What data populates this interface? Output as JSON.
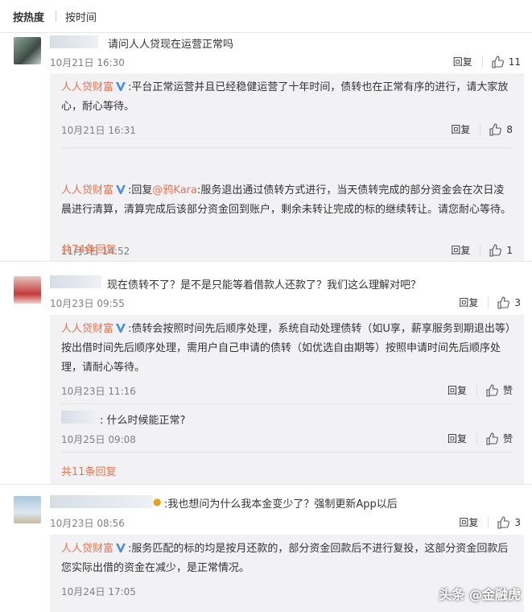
{
  "sort": {
    "hot_label": "按热度",
    "time_label": "按时间"
  },
  "threads": [
    {
      "text": "请问人人贷现在运营正常吗",
      "time": "10月21日 16:30",
      "reply_label": "回复",
      "likes": "11",
      "replies": [
        {
          "name": "人人贷财富",
          "prefix": ":",
          "text": "平台正常运营并且已经稳健运营了十年时间，债转也在正常有序的进行，请大家放心，耐心等待。",
          "time": "10月21日 16:31",
          "reply_label": "回复",
          "likes": "8"
        },
        {
          "name": "人人贷财富",
          "prefix": ":",
          "reply_word": "回复",
          "mention": "@鸦Kara",
          "text": ":服务退出通过债转方式进行，当天债转完成的部分资金会在次日凌晨进行清算，清算完成后该部分资金回到账户，剩余未转让完成的标的继续转让。请您耐心等待。",
          "time": "11月3日 14:52",
          "reply_label": "回复",
          "likes": "1"
        }
      ],
      "more": "共74条回复"
    },
    {
      "text": "现在债转不了？是不是只能等着借款人还款了？我们这么理解对吧？",
      "time": "10月23日 09:55",
      "reply_label": "回复",
      "likes": "3",
      "replies": [
        {
          "name": "人人贷财富",
          "prefix": ":",
          "text": "债转会按照时间先后顺序处理，系统自动处理债转（如U享，薪享服务到期退出等）按出借时间先后顺序处理，需用户自己申请的债转（如优选自由期等）按照申请时间先后顺序处理，请耐心等待。",
          "time": "10月23日 11:16",
          "reply_label": "回复",
          "likes": "赞"
        },
        {
          "name": "",
          "prefix": ":",
          "text": "什么时候能正常?",
          "time": "10月25日 09:08",
          "reply_label": "回复",
          "likes": "赞"
        }
      ],
      "more": "共11条回复"
    },
    {
      "text": ":我也想问为什么我本金变少了？强制更新App以后",
      "time": "10月23日 08:56",
      "reply_label": "回复",
      "likes": "3",
      "replies": [
        {
          "name": "人人贷财富",
          "prefix": ":",
          "text": "服务匹配的标的均是按月还款的，部分资金回款后不进行复投，这部分资金回款后您实际出借的资金在减少，是正常情况。",
          "time": "10月24日 17:05"
        }
      ]
    }
  ],
  "watermark": "头条 @金融虎",
  "colors": {
    "accent": "#eb7350",
    "verified": "#4a90e2",
    "reply_bg": "#f2f2f5"
  }
}
